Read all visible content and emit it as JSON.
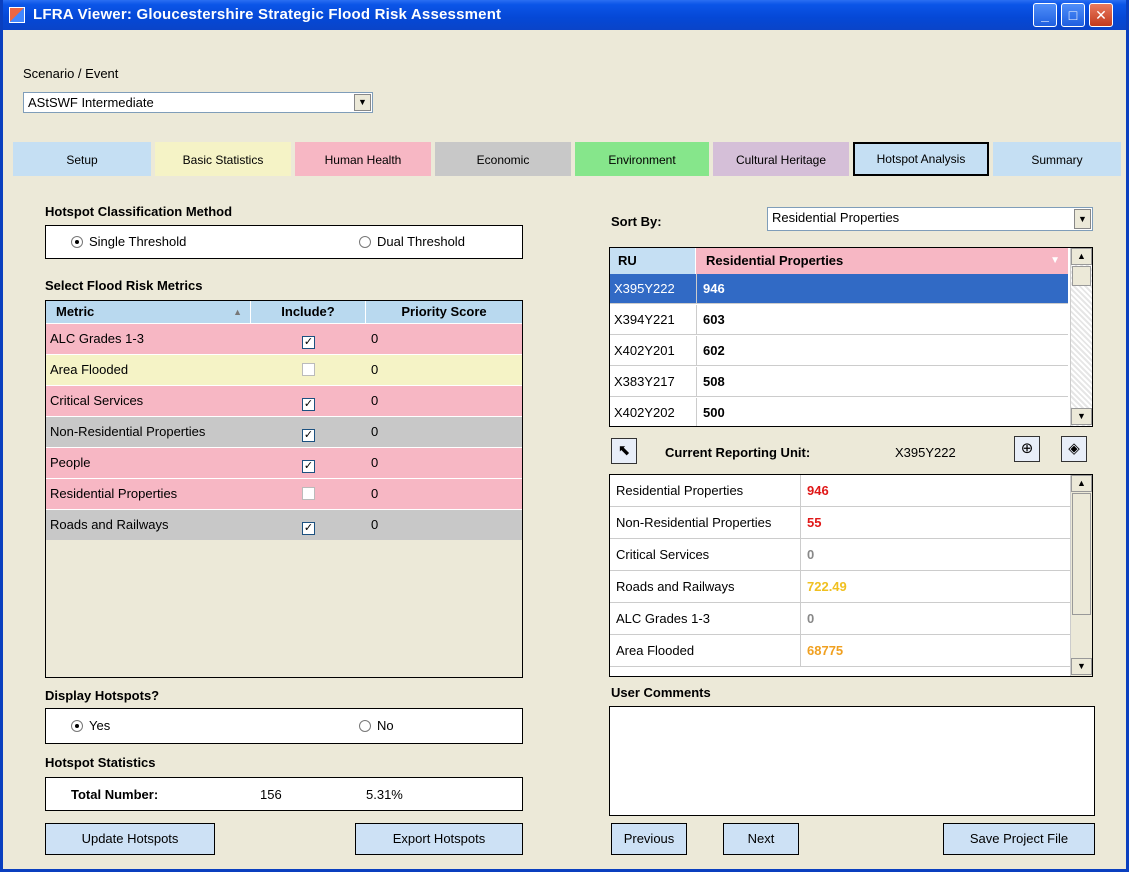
{
  "window": {
    "title": "LFRA Viewer: Gloucestershire Strategic Flood Risk Assessment"
  },
  "scenario": {
    "label": "Scenario / Event",
    "value": "AStSWF Intermediate"
  },
  "tabs": [
    {
      "label": "Setup",
      "color": "#c5dff3"
    },
    {
      "label": "Basic Statistics",
      "color": "#f5f3c6"
    },
    {
      "label": "Human Health",
      "color": "#f7b7c4"
    },
    {
      "label": "Economic",
      "color": "#c8c8c8"
    },
    {
      "label": "Environment",
      "color": "#86e68b"
    },
    {
      "label": "Cultural Heritage",
      "color": "#d5bfd8"
    },
    {
      "label": "Hotspot Analysis",
      "color": "#c5dff3"
    },
    {
      "label": "Summary",
      "color": "#c5dff3"
    }
  ],
  "classification": {
    "heading": "Hotspot Classification Method",
    "single_label": "Single Threshold",
    "dual_label": "Dual Threshold"
  },
  "metrics": {
    "heading": "Select Flood Risk Metrics",
    "columns": [
      "Metric",
      "Include?",
      "Priority Score"
    ],
    "rows": [
      {
        "name": "ALC Grades 1-3",
        "include": true,
        "score": "0",
        "color": "#f7b7c4"
      },
      {
        "name": "Area Flooded",
        "include": false,
        "score": "0",
        "color": "#f5f3c6"
      },
      {
        "name": "Critical Services",
        "include": true,
        "score": "0",
        "color": "#f7b7c4"
      },
      {
        "name": "Non-Residential Properties",
        "include": true,
        "score": "0",
        "color": "#c8c8c8"
      },
      {
        "name": "People",
        "include": true,
        "score": "0",
        "color": "#f7b7c4"
      },
      {
        "name": "Residential Properties",
        "include": false,
        "score": "0",
        "color": "#f7b7c4"
      },
      {
        "name": "Roads and Railways",
        "include": true,
        "score": "0",
        "color": "#c8c8c8"
      }
    ]
  },
  "display": {
    "heading": "Display Hotspots?",
    "yes_label": "Yes",
    "no_label": "No"
  },
  "stats": {
    "heading": "Hotspot Statistics",
    "total_label": "Total Number:",
    "count": "156",
    "percent": "5.31%"
  },
  "buttons": {
    "update": "Update Hotspots",
    "export": "Export Hotspots",
    "previous": "Previous",
    "next": "Next",
    "save": "Save Project File"
  },
  "sort": {
    "label": "Sort By:",
    "value": "Residential Properties"
  },
  "rulist": {
    "columns": [
      "RU",
      "Residential Properties"
    ],
    "rows": [
      {
        "ru": "X395Y222",
        "value": "946"
      },
      {
        "ru": "X394Y221",
        "value": "603"
      },
      {
        "ru": "X402Y201",
        "value": "602"
      },
      {
        "ru": "X383Y217",
        "value": "508"
      },
      {
        "ru": "X402Y202",
        "value": "500"
      }
    ]
  },
  "current": {
    "label": "Current Reporting Unit:",
    "value": "X395Y222"
  },
  "details": [
    {
      "name": "Residential Properties",
      "value": "946",
      "color": "#e01818"
    },
    {
      "name": "Non-Residential Properties",
      "value": "55",
      "color": "#e01818"
    },
    {
      "name": "Critical Services",
      "value": "0",
      "color": "#888888"
    },
    {
      "name": "Roads and Railways",
      "value": "722.49",
      "color": "#f0c020"
    },
    {
      "name": "ALC Grades 1-3",
      "value": "0",
      "color": "#888888"
    },
    {
      "name": "Area Flooded",
      "value": "68775",
      "color": "#f0a020"
    }
  ],
  "comments": {
    "label": "User Comments",
    "value": ""
  }
}
